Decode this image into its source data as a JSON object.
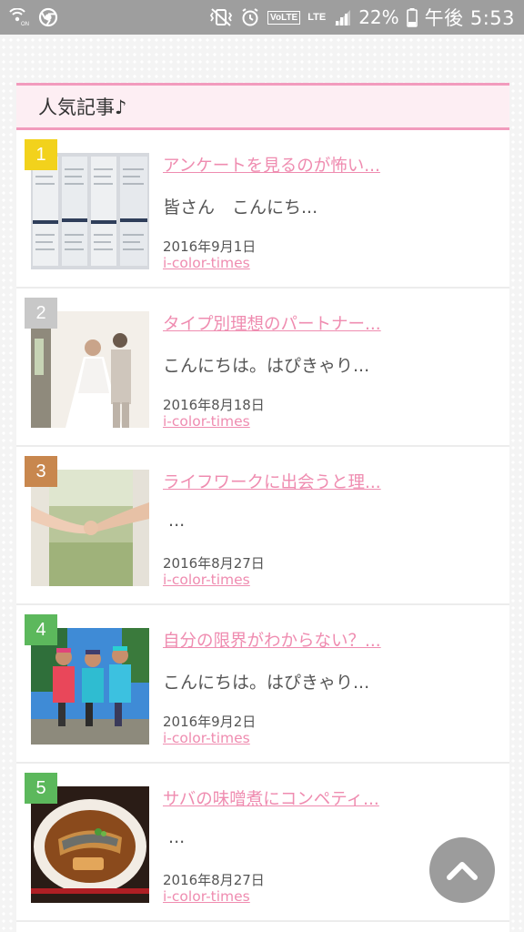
{
  "status_bar": {
    "battery": "22%",
    "clock": "午後 5:53",
    "volte": "VoLTE",
    "network": "LTE",
    "icons": [
      "hotspot-icon",
      "chrome-icon",
      "vibrate-icon",
      "alarm-icon",
      "volte-icon",
      "lte-icon",
      "signal-icon",
      "battery-icon"
    ]
  },
  "widget": {
    "title": "人気記事♪",
    "items": [
      {
        "rank": "1",
        "rank_color": "#f2d21c",
        "title": "アンケートを見るのが怖い...",
        "excerpt": "皆さん　こんにち...",
        "date": "2016年9月1日",
        "source": "i-color-times",
        "thumbnail": "survey-papers"
      },
      {
        "rank": "2",
        "rank_color": "#c8c8c8",
        "title": "タイプ別理想のパートナー...",
        "excerpt": "こんにちは。はぴきゃり...",
        "date": "2016年8月18日",
        "source": "i-color-times",
        "thumbnail": "wedding-couple"
      },
      {
        "rank": "3",
        "rank_color": "#c8874e",
        "title": "ライフワークに出会うと理...",
        "excerpt": " ...",
        "date": "2016年8月27日",
        "source": "i-color-times",
        "thumbnail": "holding-hands"
      },
      {
        "rank": "4",
        "rank_color": "#5cb85c",
        "title": "自分の限界がわからない？...",
        "excerpt": "こんにちは。はぴきゃり...",
        "date": "2016年9月2日",
        "source": "i-color-times",
        "thumbnail": "runners-group"
      },
      {
        "rank": "5",
        "rank_color": "#5cb85c",
        "title": "サバの味噌煮にコンペティ...",
        "excerpt": " ...",
        "date": "2016年8月27日",
        "source": "i-color-times",
        "thumbnail": "saba-misoni-dish"
      }
    ]
  },
  "scroll_top_button": {
    "icon": "chevron-up-icon"
  }
}
